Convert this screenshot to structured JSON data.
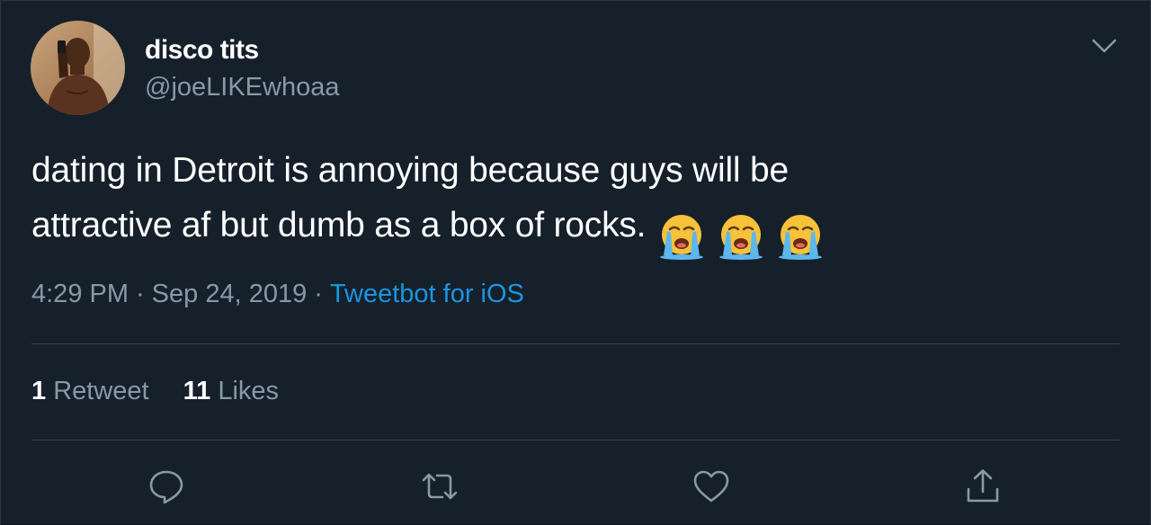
{
  "user": {
    "display_name": "disco tits",
    "handle": "@joeLIKEwhoaa",
    "avatar": "profile-photo"
  },
  "tweet": {
    "text_line1": "dating in Detroit is annoying because guys will be",
    "text_line2": "attractive af but dumb as a box of rocks.",
    "emojis": [
      "loudly-crying-face",
      "loudly-crying-face",
      "loudly-crying-face"
    ],
    "time": "4:29 PM",
    "separator": "·",
    "date": "Sep 24, 2019",
    "source": "Tweetbot for iOS"
  },
  "stats": {
    "retweets_count": "1",
    "retweets_label": "Retweet",
    "likes_count": "11",
    "likes_label": "Likes"
  },
  "actions": [
    "reply-icon",
    "retweet-icon",
    "like-icon",
    "share-icon"
  ],
  "colors": {
    "background": "#15202b",
    "text_primary": "#ffffff",
    "text_secondary": "#8899a6",
    "link": "#1b95e0",
    "divider": "#38444d"
  }
}
